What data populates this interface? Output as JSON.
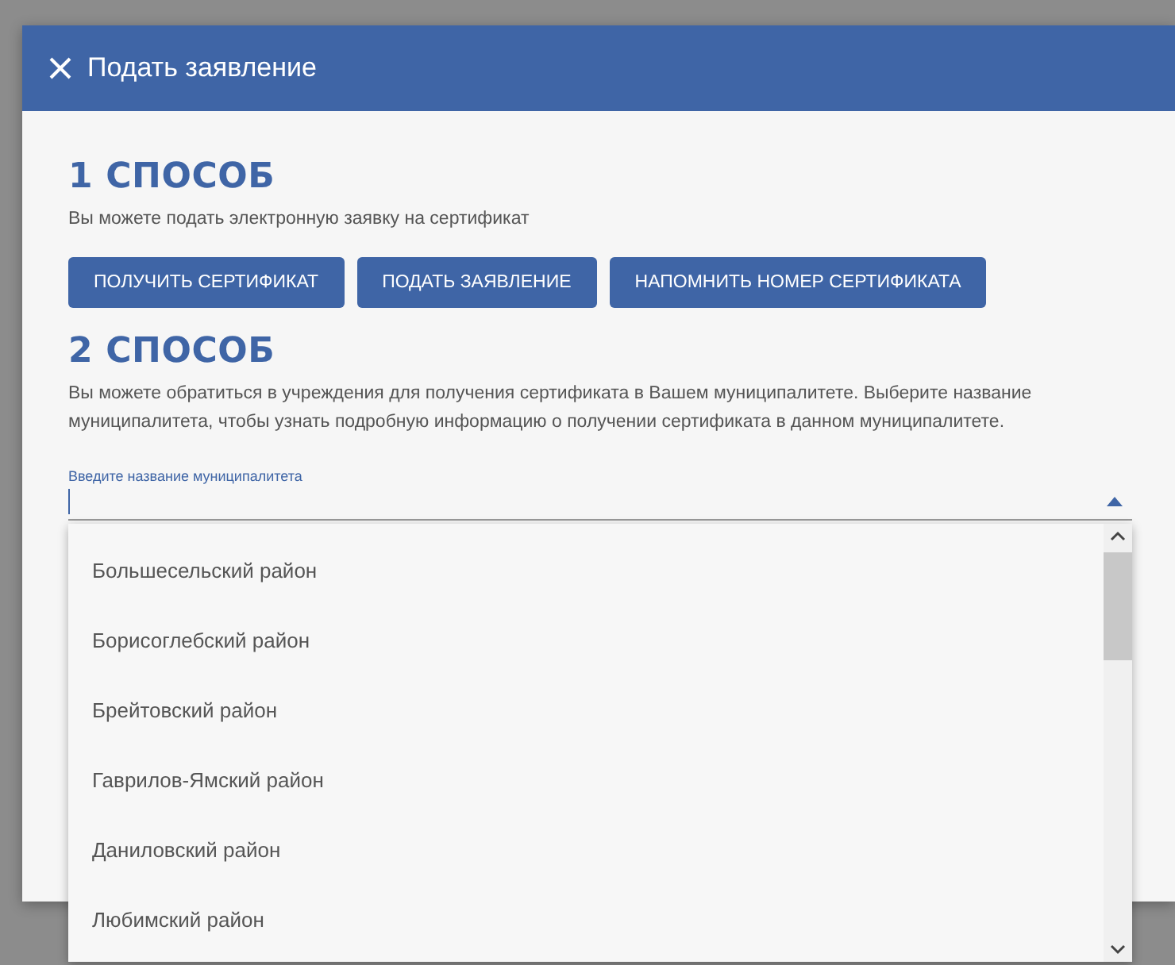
{
  "dialog": {
    "title": "Подать заявление"
  },
  "method_1": {
    "heading": "1 СПОСОБ",
    "text": "Вы можете подать электронную заявку на сертификат",
    "buttons": [
      "ПОЛУЧИТЬ СЕРТИФИКАТ",
      "ПОДАТЬ ЗАЯВЛЕНИЕ",
      "НАПОМНИТЬ НОМЕР СЕРТИФИКАТА"
    ]
  },
  "method_2": {
    "heading": "2 СПОСОБ",
    "text": "Вы можете обратиться в учреждения для получения сертификата в Вашем муниципалитете. Выберите название муниципалитета, чтобы узнать подробную информацию о получении сертификата в данном муниципалитете."
  },
  "municipality_field": {
    "label": "Введите название муниципалитета",
    "expanded": true,
    "options": [
      "Большесельский район",
      "Борисоглебский район",
      "Брейтовский район",
      "Гаврилов-Ямский район",
      "Даниловский район",
      "Любимский район"
    ]
  }
}
